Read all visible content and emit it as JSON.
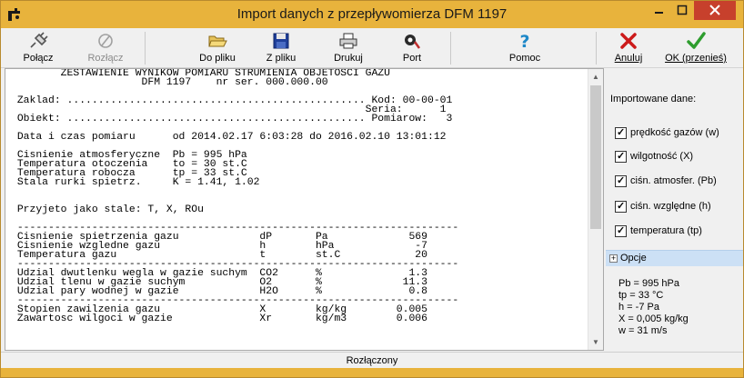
{
  "window": {
    "title": "Import danych z przepływomierza DFM 1197"
  },
  "toolbar": {
    "connect": "Połącz",
    "disconnect": "Rozłącz",
    "to_file": "Do pliku",
    "from_file": "Z pliku",
    "print": "Drukuj",
    "port": "Port",
    "help": "Pomoc",
    "cancel": "Anuluj",
    "ok": "OK (przenieś)"
  },
  "report": {
    "lines": [
      "        ZESTAWIENIE WYNIKOW POMIARU STRUMIENIA OBJETOSCI GAZU",
      "                     DFM 1197    nr ser. 000.000.00",
      "",
      " Zaklad: ................................................ Kod: 00-00-01",
      "                                                         Seria:      1",
      " Obiekt: ................................................ Pomiarow:   3",
      "",
      " Data i czas pomiaru      od 2014.02.17 6:03:28 do 2016.02.10 13:01:12",
      "",
      " Cisnienie atmosferyczne  Pb = 995 hPa",
      " Temperatura otoczenia    to = 30 st.C",
      " Temperatura robocza      tp = 33 st.C",
      " Stala rurki spietrz.     K = 1.41, 1.02",
      "",
      "",
      " Przyjeto jako stale: T, X, ROu",
      "",
      " -----------------------------------------------------------------------",
      " Cisnienie spietrzenia gazu             dP       Pa             569",
      " Cisnienie wzgledne gazu                h        hPa             -7",
      " Temperatura gazu                       t        st.C            20",
      " -----------------------------------------------------------------------",
      " Udzial dwutlenku wegla w gazie suchym  CO2      %              1.3",
      " Udzial tlenu w gazie suchym            O2       %             11.3",
      " Udzial pary wodnej w gazie             H2O      %              0.8",
      " -----------------------------------------------------------------------",
      " Stopien zawilzenia gazu                X        kg/kg        0.005",
      " Zawartosc wilgoci w gazie              Xr       kg/m3        0.006"
    ]
  },
  "side": {
    "title": "Importowane dane:",
    "checks": [
      {
        "label": "prędkość gazów (w)",
        "checked": true
      },
      {
        "label": "wilgotność (X)",
        "checked": true
      },
      {
        "label": "ciśn. atmosfer. (Pb)",
        "checked": true
      },
      {
        "label": "ciśn. względne (h)",
        "checked": true
      },
      {
        "label": "temperatura (tp)",
        "checked": true
      }
    ],
    "options_label": "Opcje",
    "params": [
      "Pb = 995 hPa",
      "tp = 33 °C",
      "h = -7 Pa",
      "X = 0,005 kg/kg",
      "w = 31 m/s"
    ]
  },
  "status": {
    "text": "Rozłączony"
  }
}
